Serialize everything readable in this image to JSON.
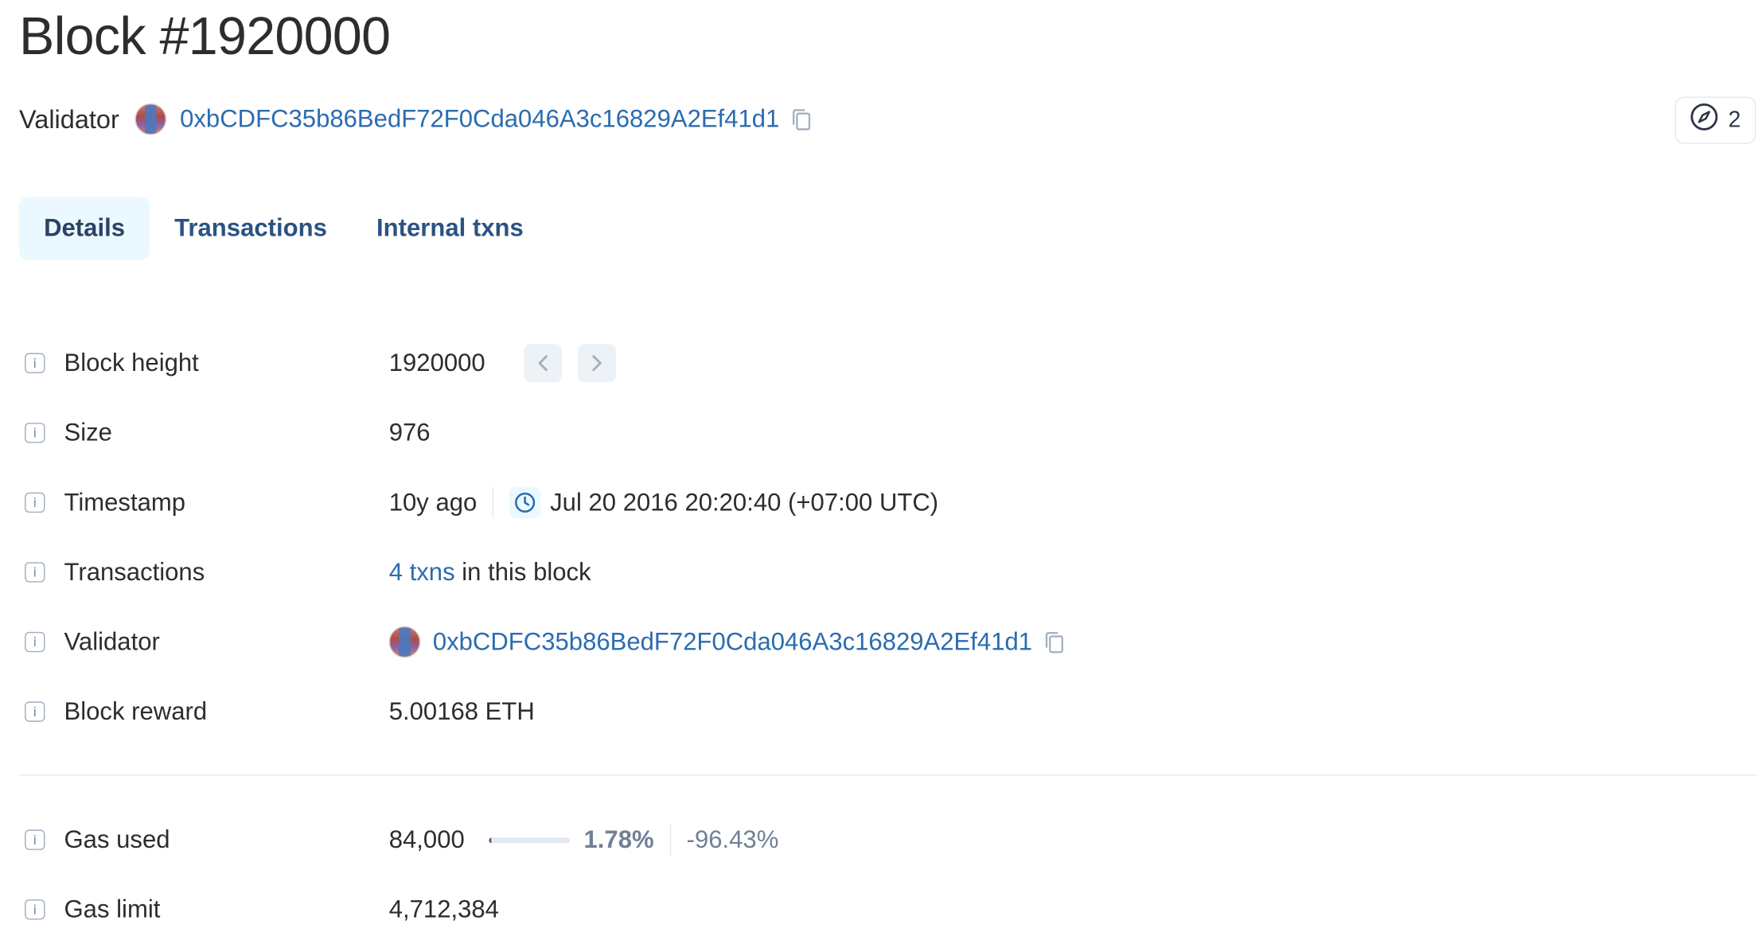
{
  "header": {
    "title": "Block #1920000",
    "validator_label": "Validator",
    "validator_address": "0xbCDFC35b86BedF72F0Cda046A3c16829A2Ef41d1",
    "count": "2"
  },
  "tabs": [
    {
      "label": "Details",
      "active": true
    },
    {
      "label": "Transactions",
      "active": false
    },
    {
      "label": "Internal txns",
      "active": false
    }
  ],
  "details": {
    "block_height": {
      "label": "Block height",
      "value": "1920000"
    },
    "size": {
      "label": "Size",
      "value": "976"
    },
    "timestamp": {
      "label": "Timestamp",
      "relative": "10y ago",
      "absolute": "Jul 20 2016 20:20:40 (+07:00 UTC)"
    },
    "transactions": {
      "label": "Transactions",
      "link": "4 txns",
      "suffix": " in this block"
    },
    "validator": {
      "label": "Validator",
      "address": "0xbCDFC35b86BedF72F0Cda046A3c16829A2Ef41d1"
    },
    "block_reward": {
      "label": "Block reward",
      "value": "5.00168 ETH"
    },
    "gas_used": {
      "label": "Gas used",
      "value": "84,000",
      "percent": "1.78%",
      "percent_fraction": 0.0178,
      "delta": "-96.43%"
    },
    "gas_limit": {
      "label": "Gas limit",
      "value": "4,712,384"
    }
  },
  "icons": {
    "info": "info-icon",
    "copy": "copy-icon",
    "clock": "clock-icon",
    "compass": "compass-icon",
    "prev": "chevron-left-icon",
    "next": "chevron-right-icon"
  },
  "colors": {
    "link": "#2b6cb0",
    "tab_active_bg": "#ebf8ff",
    "tab_text": "#2c5282"
  }
}
